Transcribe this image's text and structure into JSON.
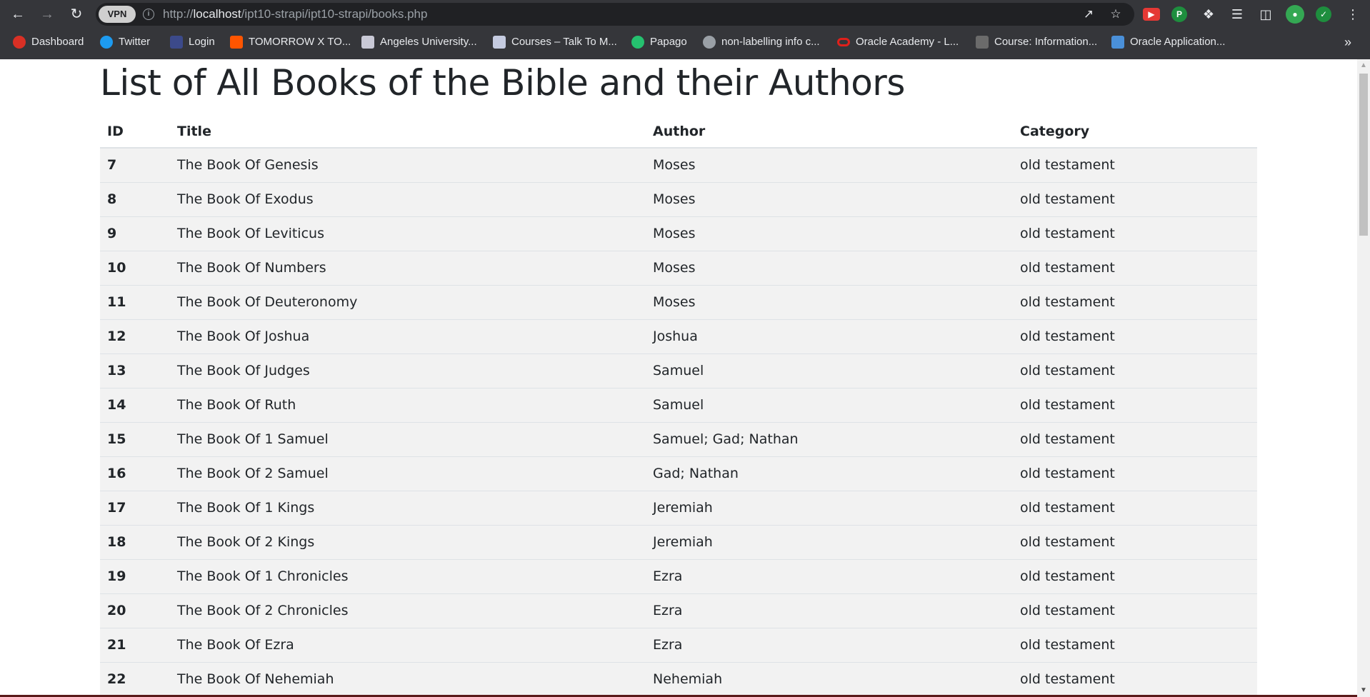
{
  "browser": {
    "vpn_label": "VPN",
    "url_prefix": "http://",
    "url_host": "localhost",
    "url_path": "/ipt10-strapi/ipt10-strapi/books.php",
    "bookmarks": [
      {
        "label": "Dashboard",
        "icon": "dashboard-icon",
        "color": "#d93025"
      },
      {
        "label": "Twitter",
        "icon": "twitter-icon",
        "color": "#1d9bf0"
      },
      {
        "label": "Login",
        "icon": "login-icon",
        "color": "#3c4a8a"
      },
      {
        "label": "TOMORROW X TO...",
        "icon": "soundcloud-icon",
        "color": "#ff5500"
      },
      {
        "label": "Angeles University...",
        "icon": "university-icon",
        "color": "#c9c9d6"
      },
      {
        "label": "Courses – Talk To M...",
        "icon": "courses-icon",
        "color": "#c5cbe0"
      },
      {
        "label": "Papago",
        "icon": "papago-icon",
        "color": "#25c16f"
      },
      {
        "label": "non-labelling info c...",
        "icon": "globe-icon",
        "color": "#9aa0a6"
      },
      {
        "label": "Oracle Academy - L...",
        "icon": "oracle-icon",
        "color": "#e0201b"
      },
      {
        "label": "Course: Information...",
        "icon": "cisco-icon",
        "color": "#6b6b6b"
      },
      {
        "label": "Oracle Application...",
        "icon": "oracle-app-icon",
        "color": "#4a90d9"
      }
    ],
    "more_bookmarks": "»"
  },
  "page": {
    "title": "List of All Books of the Bible and their Authors",
    "columns": [
      "ID",
      "Title",
      "Author",
      "Category"
    ],
    "rows": [
      {
        "id": "7",
        "title": "The Book Of Genesis",
        "author": "Moses",
        "category": "old testament"
      },
      {
        "id": "8",
        "title": "The Book Of Exodus",
        "author": "Moses",
        "category": "old testament"
      },
      {
        "id": "9",
        "title": "The Book Of Leviticus",
        "author": "Moses",
        "category": "old testament"
      },
      {
        "id": "10",
        "title": "The Book Of Numbers",
        "author": "Moses",
        "category": "old testament"
      },
      {
        "id": "11",
        "title": "The Book Of Deuteronomy",
        "author": "Moses",
        "category": "old testament"
      },
      {
        "id": "12",
        "title": "The Book Of Joshua",
        "author": "Joshua",
        "category": "old testament"
      },
      {
        "id": "13",
        "title": "The Book Of Judges",
        "author": "Samuel",
        "category": "old testament"
      },
      {
        "id": "14",
        "title": "The Book Of Ruth",
        "author": "Samuel",
        "category": "old testament"
      },
      {
        "id": "15",
        "title": "The Book Of 1 Samuel",
        "author": "Samuel; Gad; Nathan",
        "category": "old testament"
      },
      {
        "id": "16",
        "title": "The Book Of 2 Samuel",
        "author": "Gad; Nathan",
        "category": "old testament"
      },
      {
        "id": "17",
        "title": "The Book Of 1 Kings",
        "author": "Jeremiah",
        "category": "old testament"
      },
      {
        "id": "18",
        "title": "The Book Of 2 Kings",
        "author": "Jeremiah",
        "category": "old testament"
      },
      {
        "id": "19",
        "title": "The Book Of 1 Chronicles",
        "author": "Ezra",
        "category": "old testament"
      },
      {
        "id": "20",
        "title": "The Book Of 2 Chronicles",
        "author": "Ezra",
        "category": "old testament"
      },
      {
        "id": "21",
        "title": "The Book Of Ezra",
        "author": "Ezra",
        "category": "old testament"
      },
      {
        "id": "22",
        "title": "The Book Of Nehemiah",
        "author": "Nehemiah",
        "category": "old testament"
      }
    ]
  }
}
